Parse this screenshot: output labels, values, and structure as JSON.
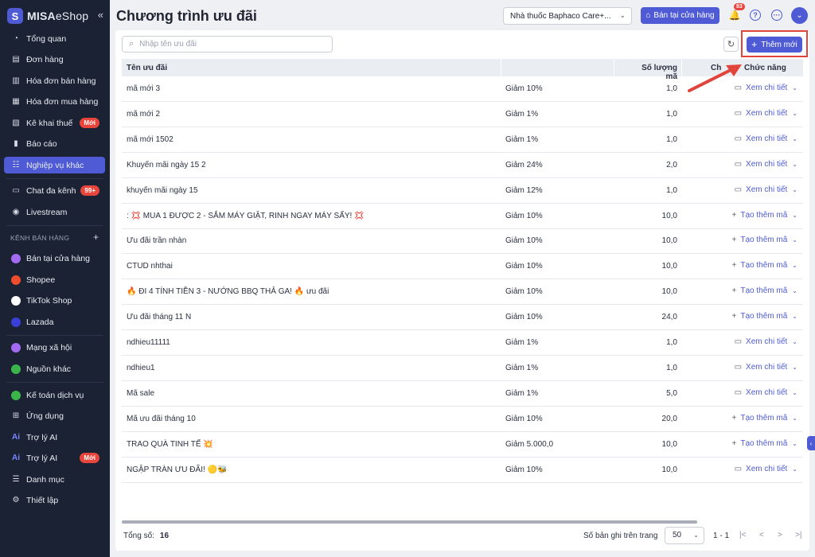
{
  "app": {
    "logo_text_bold": "MISA",
    "logo_text_light": "eShop",
    "collapse_icon": "chevrons-left-icon"
  },
  "sidebar": {
    "items": [
      {
        "label": "Tổng quan",
        "icon": "dashboard-icon"
      },
      {
        "label": "Đơn hàng",
        "icon": "order-icon"
      },
      {
        "label": "Hóa đơn bán hàng",
        "icon": "invoice-icon"
      },
      {
        "label": "Hóa đơn mua hàng",
        "icon": "purchase-invoice-icon"
      },
      {
        "label": "Kê khai thuế",
        "icon": "tax-icon",
        "badge": "Mới"
      },
      {
        "label": "Báo cáo",
        "icon": "report-icon"
      },
      {
        "label": "Nghiệp vụ khác",
        "icon": "tasks-icon",
        "active": true
      },
      {
        "label": "Chat đa kênh",
        "icon": "chat-icon",
        "badge": "99+"
      },
      {
        "label": "Livestream",
        "icon": "livestream-icon"
      }
    ],
    "channels_label": "KÊNH BÁN HÀNG",
    "channels": [
      {
        "label": "Bán tại cửa hàng",
        "icon": "store-icon",
        "color": "#a46bf0"
      },
      {
        "label": "Shopee",
        "icon": "shopee-icon",
        "color": "#ee4d2d"
      },
      {
        "label": "TikTok Shop",
        "icon": "tiktok-icon",
        "color": "#ffffff"
      },
      {
        "label": "Lazada",
        "icon": "lazada-icon",
        "color": "#3a3fd8"
      }
    ],
    "social": [
      {
        "label": "Mạng xã hội",
        "icon": "social-icon",
        "color": "#a46bf0"
      },
      {
        "label": "Nguồn khác",
        "icon": "other-source-icon",
        "color": "#3bb54a"
      }
    ],
    "bottom": [
      {
        "label": "Kế toán dịch vụ",
        "icon": "accounting-icon",
        "color": "#3bb54a"
      },
      {
        "label": "Ứng dụng",
        "icon": "apps-icon"
      },
      {
        "label": "Trợ lý AI",
        "icon": "ai-icon"
      },
      {
        "label": "Trợ lý AI",
        "icon": "ai-icon",
        "badge": "Mới"
      },
      {
        "label": "Danh mục",
        "icon": "list-icon"
      },
      {
        "label": "Thiết lập",
        "icon": "settings-icon"
      }
    ]
  },
  "header": {
    "title": "Chương trình ưu đãi",
    "store_select": "Nhà thuốc Baphaco Care+...",
    "store_button": "Bán tại cửa hàng",
    "notification_count": "83",
    "avatar_icon": "chevron-down-icon"
  },
  "toolbar": {
    "search_placeholder": "Nhập tên ưu đãi",
    "add_label": "Thêm mới"
  },
  "table": {
    "headers": {
      "name": "Tên ưu đãi",
      "quantity": "Số lượng mã",
      "partial": "Ch",
      "actions": "Chức năng"
    },
    "rows": [
      {
        "name": "mã mới 3",
        "discount": "Giảm 10%",
        "qty": "1,0",
        "action": "Xem chi tiết",
        "action_icon": "message-icon"
      },
      {
        "name": "mã mới 2",
        "discount": "Giảm 1%",
        "qty": "1,0",
        "action": "Xem chi tiết",
        "action_icon": "message-icon"
      },
      {
        "name": "mã mới 1502",
        "discount": "Giảm 1%",
        "qty": "1,0",
        "action": "Xem chi tiết",
        "action_icon": "message-icon"
      },
      {
        "name": "Khuyến mãi ngày 15 2",
        "discount": "Giảm 24%",
        "qty": "2,0",
        "action": "Xem chi tiết",
        "action_icon": "message-icon"
      },
      {
        "name": "khuyến mãi ngày 15",
        "discount": "Giảm 12%",
        "qty": "1,0",
        "action": "Xem chi tiết",
        "action_icon": "message-icon"
      },
      {
        "name": ": 💢 MUA 1 ĐƯỢC 2 - SẮM MÁY GIẶT, RINH NGAY MÁY SẤY! 💢",
        "discount": "Giảm 10%",
        "qty": "10,0",
        "action": "Tạo thêm mã",
        "action_icon": "plus-icon"
      },
      {
        "name": "Ưu đãi trần nhàn",
        "discount": "Giảm 10%",
        "qty": "10,0",
        "action": "Tạo thêm mã",
        "action_icon": "plus-icon"
      },
      {
        "name": "CTUD nhthai",
        "discount": "Giảm 10%",
        "qty": "10,0",
        "action": "Tạo thêm mã",
        "action_icon": "plus-icon"
      },
      {
        "name": "🔥 ĐI 4 TÍNH TIỀN 3 - NƯỚNG BBQ THẢ GA! 🔥 ưu đãi",
        "discount": "Giảm 10%",
        "qty": "10,0",
        "action": "Tạo thêm mã",
        "action_icon": "plus-icon"
      },
      {
        "name": "Ưu đãi tháng 11 N",
        "discount": "Giảm 10%",
        "qty": "24,0",
        "action": "Tạo thêm mã",
        "action_icon": "plus-icon"
      },
      {
        "name": "ndhieu11111",
        "discount": "Giảm 1%",
        "qty": "1,0",
        "action": "Xem chi tiết",
        "action_icon": "message-icon"
      },
      {
        "name": "ndhieu1",
        "discount": "Giảm 1%",
        "qty": "1,0",
        "action": "Xem chi tiết",
        "action_icon": "message-icon"
      },
      {
        "name": "Mã sale",
        "discount": "Giảm 1%",
        "qty": "5,0",
        "action": "Xem chi tiết",
        "action_icon": "message-icon"
      },
      {
        "name": "Mã ưu đãi tháng 10",
        "discount": "Giảm 10%",
        "qty": "20,0",
        "action": "Tạo thêm mã",
        "action_icon": "plus-icon"
      },
      {
        "name": "TRAO QUÀ TINH TẾ 💥",
        "discount": "Giảm 5.000,0",
        "qty": "10,0",
        "action": "Tạo thêm mã",
        "action_icon": "plus-icon"
      },
      {
        "name": "NGẬP TRÀN ƯU ĐÃI! 🟡🐝",
        "discount": "Giảm 10%",
        "qty": "10,0",
        "action": "Xem chi tiết",
        "action_icon": "message-icon"
      }
    ]
  },
  "footer": {
    "total_label": "Tổng số:",
    "total_value": "16",
    "per_page_label": "Số bản ghi trên trang",
    "per_page_value": "50",
    "range": "1 - 1"
  },
  "colors": {
    "accent": "#4f5bd5",
    "sidebar_bg": "#1b2233",
    "badge": "#e8453c",
    "highlight": "#e0443b"
  }
}
